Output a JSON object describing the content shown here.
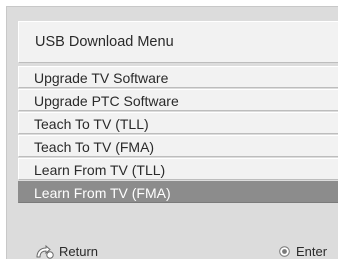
{
  "menu": {
    "title": "USB Download Menu",
    "items": [
      {
        "label": "Upgrade TV Software"
      },
      {
        "label": "Upgrade PTC Software"
      },
      {
        "label": "Teach To TV (TLL)"
      },
      {
        "label": "Teach To TV (FMA)"
      },
      {
        "label": "Learn From TV (TLL)"
      },
      {
        "label": "Learn From TV (FMA)"
      }
    ],
    "selected_index": 5
  },
  "footer": {
    "return_label": "Return",
    "return_icon": "return-arrow-icon",
    "enter_label": "Enter",
    "enter_icon": "ok-button-icon"
  },
  "colors": {
    "panel_background": "#dcdcdc",
    "item_background": "#f2f2f2",
    "selected_background": "#8c8c8c",
    "selected_text": "#ffffff",
    "text": "#2a2a2a"
  }
}
